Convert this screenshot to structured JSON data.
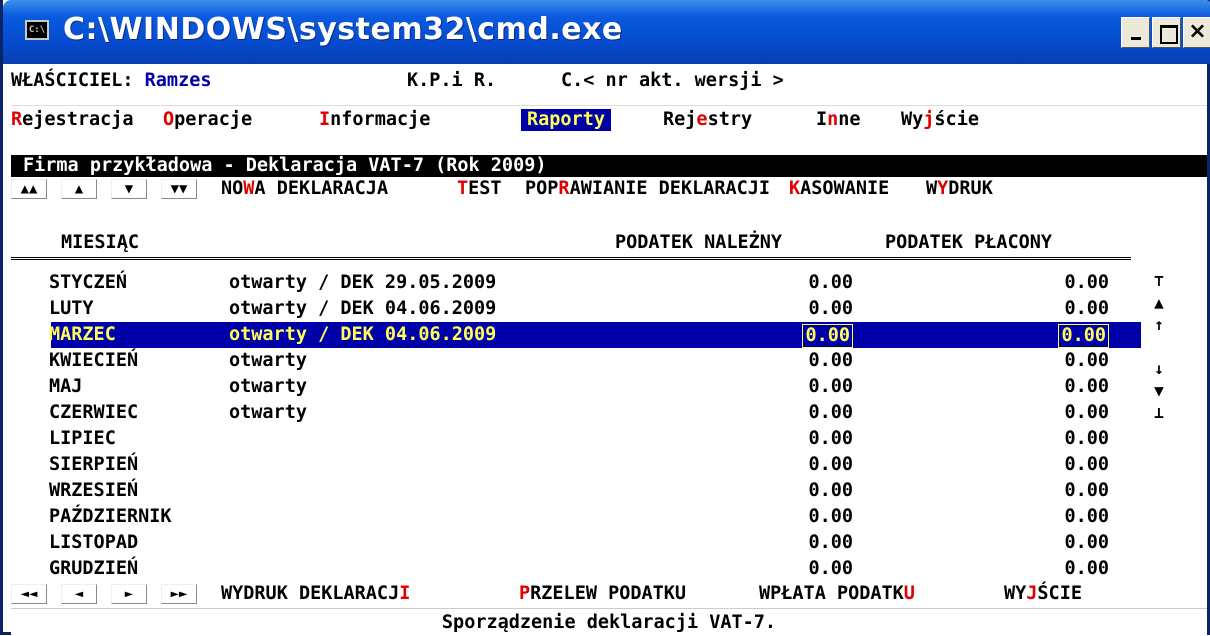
{
  "window": {
    "title": "C:\\WINDOWS\\system32\\cmd.exe",
    "icon_text": "C:\\",
    "minimize_label": "_",
    "maximize_label": "",
    "close_label": "×"
  },
  "header": {
    "owner_label": "WŁAŚCICIEL: ",
    "owner_value": "Ramzes",
    "program": "K.P.i R.",
    "version": "C.< nr akt. wersji >"
  },
  "menu": [
    {
      "hot": "R",
      "rest": "ejestracja"
    },
    {
      "hot": "O",
      "rest": "peracje"
    },
    {
      "hot": "I",
      "rest": "nformacje"
    },
    {
      "hot": "",
      "rest": "Raporty",
      "active": true
    },
    {
      "pre": "Rej",
      "hot": "e",
      "rest": "stry"
    },
    {
      "pre": "I",
      "hot": "n",
      "rest": "ne"
    },
    {
      "pre": "Wy",
      "hot": "j",
      "rest": "ście"
    }
  ],
  "infobar": "Firma przykładowa - Deklaracja VAT-7 (Rok 2009)",
  "top_nav": [
    "▲▲",
    "▲",
    "▼",
    "▼▼"
  ],
  "top_actions": [
    {
      "pre": "NO",
      "hot": "W",
      "rest": "A DEKLARACJA"
    },
    {
      "pre": "",
      "hot": "T",
      "rest": "EST"
    },
    {
      "pre": "POP",
      "hot": "R",
      "rest": "AWIANIE DEKLARACJI"
    },
    {
      "pre": "",
      "hot": "K",
      "rest": "ASOWANIE"
    },
    {
      "pre": "W",
      "hot": "Y",
      "rest": "DRUK"
    }
  ],
  "columns": {
    "month": "MIESIĄC",
    "due": "PODATEK NALEŻNY",
    "paid": "PODATEK PŁACONY"
  },
  "months": [
    {
      "name": "STYCZEŃ",
      "status": "otwarty / DEK 29.05.2009",
      "due": "0.00",
      "paid": "0.00"
    },
    {
      "name": "LUTY",
      "status": "otwarty / DEK 04.06.2009",
      "due": "0.00",
      "paid": "0.00"
    },
    {
      "name": "MARZEC",
      "status": "otwarty / DEK 04.06.2009",
      "due": "0.00",
      "paid": "0.00",
      "selected": true
    },
    {
      "name": "KWIECIEŃ",
      "status": "otwarty",
      "due": "0.00",
      "paid": "0.00"
    },
    {
      "name": "MAJ",
      "status": "otwarty",
      "due": "0.00",
      "paid": "0.00"
    },
    {
      "name": "CZERWIEC",
      "status": "otwarty",
      "due": "0.00",
      "paid": "0.00"
    },
    {
      "name": "LIPIEC",
      "status": "",
      "due": "0.00",
      "paid": "0.00"
    },
    {
      "name": "SIERPIEŃ",
      "status": "",
      "due": "0.00",
      "paid": "0.00"
    },
    {
      "name": "WRZESIEŃ",
      "status": "",
      "due": "0.00",
      "paid": "0.00"
    },
    {
      "name": "PAŹDZIERNIK",
      "status": "",
      "due": "0.00",
      "paid": "0.00"
    },
    {
      "name": "LISTOPAD",
      "status": "",
      "due": "0.00",
      "paid": "0.00"
    },
    {
      "name": "GRUDZIEŃ",
      "status": "",
      "due": "0.00",
      "paid": "0.00"
    }
  ],
  "scrollbar": [
    "⊤",
    "▲",
    "↑",
    "",
    "↓",
    "▼",
    "⊥"
  ],
  "bottom_nav": [
    "◄◄",
    "◄",
    "►",
    "►►"
  ],
  "bottom_actions": [
    {
      "pre": "WYDRUK DEKLARACJ",
      "hot": "I",
      "rest": ""
    },
    {
      "pre": "",
      "hot": "P",
      "rest": "RZELEW PODATKU"
    },
    {
      "pre": "WPŁATA PODATK",
      "hot": "U",
      "rest": ""
    },
    {
      "pre": "WY",
      "hot": "J",
      "rest": "ŚCIE"
    }
  ],
  "status": "Sporządzenie deklaracji VAT-7.",
  "colors": {
    "title_bar": "#0a5be0",
    "highlight_bg": "#0000a8",
    "highlight_fg": "#ffff55",
    "hotkey": "#e00000"
  }
}
